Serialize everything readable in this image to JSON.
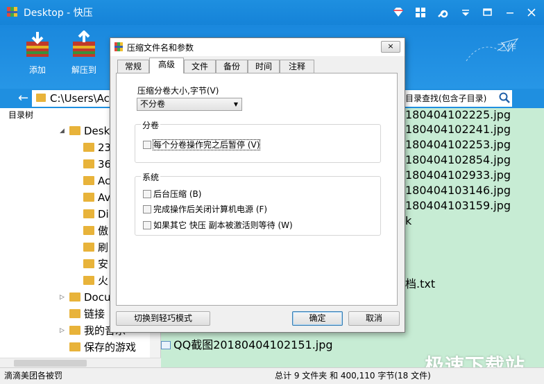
{
  "window": {
    "title": "Desktop - 快压"
  },
  "toolbar": {
    "add_label": "添加",
    "extract_label": "解压到",
    "slogan": "之作"
  },
  "address": {
    "path": "C:\\Users\\Ac",
    "search_placeholder": "目录查找(包含子目录)"
  },
  "tree": {
    "header": "目录树",
    "items": [
      {
        "label": "Desk",
        "expanded": true
      },
      {
        "label": "23"
      },
      {
        "label": "36"
      },
      {
        "label": "Ac"
      },
      {
        "label": "Av"
      },
      {
        "label": "Di"
      },
      {
        "label": "傲"
      },
      {
        "label": "刷"
      },
      {
        "label": "安"
      },
      {
        "label": "火"
      },
      {
        "label": "Docu"
      },
      {
        "label": "链接"
      },
      {
        "label": "我的音乐"
      },
      {
        "label": "保存的游戏"
      }
    ]
  },
  "files": {
    "partial_names": [
      "180404102225.jpg",
      "180404102241.jpg",
      "180404102253.jpg",
      "180404102854.jpg",
      "180404102933.jpg",
      "180404103146.jpg",
      "180404103159.jpg",
      "k",
      "档.txt"
    ],
    "full_row": "QQ截图20180404102151.jpg"
  },
  "watermark": "极速下载站",
  "status": {
    "left": "滴滴美团各被罚",
    "right": "总计 9 文件夹 和 400,110 字节(18 文件)"
  },
  "dialog": {
    "title": "压缩文件名和参数",
    "close_label": "×",
    "tabs": [
      "常规",
      "高级",
      "文件",
      "备份",
      "时间",
      "注释"
    ],
    "active_tab": "高级",
    "split_label": "压缩分卷大小,字节(V)",
    "split_value": "不分卷",
    "group_split": {
      "title": "分卷",
      "checkbox": "每个分卷操作完之后暂停 (V)"
    },
    "group_system": {
      "title": "系统",
      "checkboxes": [
        "后台压缩 (B)",
        "完成操作后关闭计算机电源 (F)",
        "如果其它 快压 副本被激活则等待 (W)"
      ]
    },
    "switch_label": "切换到轻巧模式",
    "ok_label": "确定",
    "cancel_label": "取消"
  },
  "colors": {
    "titlebar": "#1e8fe0",
    "filelist_bg": "#c7ecd4",
    "folder": "#e8b33a"
  }
}
